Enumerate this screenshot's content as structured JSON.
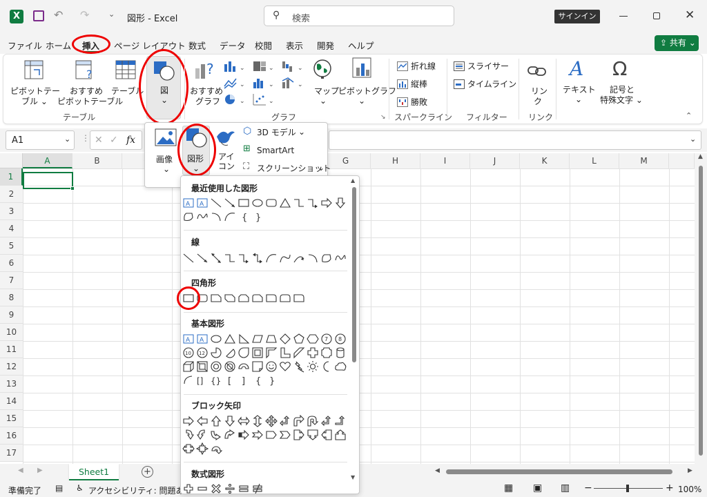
{
  "titlebar": {
    "app_title": "図形 - Excel",
    "search_placeholder": "検索",
    "signin": "サインイン"
  },
  "menu": {
    "tabs": [
      "ファイル",
      "ホーム",
      "挿入",
      "ページ レイアウト",
      "数式",
      "データ",
      "校閲",
      "表示",
      "開発",
      "ヘルプ"
    ],
    "share": "共有"
  },
  "ribbon": {
    "pivot_l1": "ピボットテー",
    "pivot_l2": "ブル ⌄",
    "rec_pivot_l1": "おすすめ",
    "rec_pivot_l2": "ピボットテーブル",
    "table": "テーブル",
    "illust": "図",
    "rec_chart_l1": "おすすめ",
    "rec_chart_l2": "グラフ",
    "map": "マップ",
    "pivotchart": "ピボットグラフ",
    "spark_line": "折れ線",
    "spark_col": "縦棒",
    "spark_wl": "勝敗",
    "slicer": "スライサー",
    "timeline": "タイムライン",
    "link_l1": "リン",
    "link_l2": "ク",
    "text": "テキスト",
    "symbol_l1": "記号と",
    "symbol_l2": "特殊文字 ⌄",
    "group_table": "テーブル",
    "group_chart": "グラフ",
    "group_spark": "スパークライン",
    "group_filter": "フィルター",
    "group_link": "リンク"
  },
  "formula": {
    "namebox": "A1",
    "fx": "fx"
  },
  "grid": {
    "columns": [
      "A",
      "B",
      "C",
      "D",
      "E",
      "F",
      "G",
      "H",
      "I",
      "J",
      "K",
      "L",
      "M"
    ],
    "rows": [
      "1",
      "2",
      "3",
      "4",
      "5",
      "6",
      "7",
      "8",
      "9",
      "10",
      "11",
      "12",
      "13",
      "14",
      "15",
      "16",
      "17"
    ]
  },
  "sheettabs": {
    "active": "Sheet1"
  },
  "status": {
    "ready": "準備完了",
    "accessibility": "アクセシビリティ: 問題ありませ",
    "zoom": "100%"
  },
  "illust_panel": {
    "image": "画像",
    "shapes": "図形",
    "icon_l1": "アイ",
    "icon_l2": "コン",
    "model3d": "3D モデル",
    "smartart": "SmartArt",
    "screenshot": "スクリーンショット"
  },
  "shapes_gallery": {
    "recent": "最近使用した図形",
    "lines": "線",
    "rectangles": "四角形",
    "basic": "基本図形",
    "block_arrows": "ブロック矢印",
    "equation": "数式図形"
  },
  "colors": {
    "excel_green": "#107c41",
    "accent_blue": "#2b6cc4",
    "highlight_red": "#e00000"
  }
}
